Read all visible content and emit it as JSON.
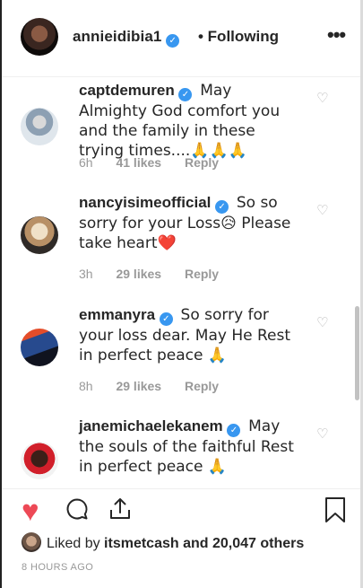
{
  "header": {
    "username": "annieidibia1",
    "following_label": "• Following",
    "more_label": "•••"
  },
  "comments": [
    {
      "user": "captdemuren",
      "text": "May Almighty God comfort you and the family in these trying times....🙏🙏🙏",
      "time": "6h",
      "likes": "41 likes",
      "reply": "Reply"
    },
    {
      "user": "nancyisimeofficial",
      "text": "So so sorry for your Loss😥 Please take heart❤️",
      "time": "3h",
      "likes": "29 likes",
      "reply": "Reply"
    },
    {
      "user": "emmanyra",
      "text": "So sorry for your loss dear. May He Rest in perfect peace 🙏",
      "time": "8h",
      "likes": "29 likes",
      "reply": "Reply"
    },
    {
      "user": "janemichaelekanem",
      "text": "May the souls of the faithful Rest in perfect peace 🙏",
      "time": "",
      "likes": "",
      "reply": ""
    }
  ],
  "footer": {
    "liked_by_prefix": "Liked by",
    "liked_by_user": "itsmetcash",
    "liked_by_suffix": "and 20,047 others",
    "timestamp": "8 HOURS AGO"
  },
  "colors": {
    "like_red": "#ed4956",
    "verified_blue": "#3897f0",
    "meta_gray": "#999999"
  },
  "icons": {
    "verified": "verified-badge-icon",
    "comment_heart": "heart-outline-icon",
    "like": "heart-filled-icon",
    "comment": "comment-bubble-icon",
    "share": "share-icon",
    "save": "bookmark-icon"
  }
}
